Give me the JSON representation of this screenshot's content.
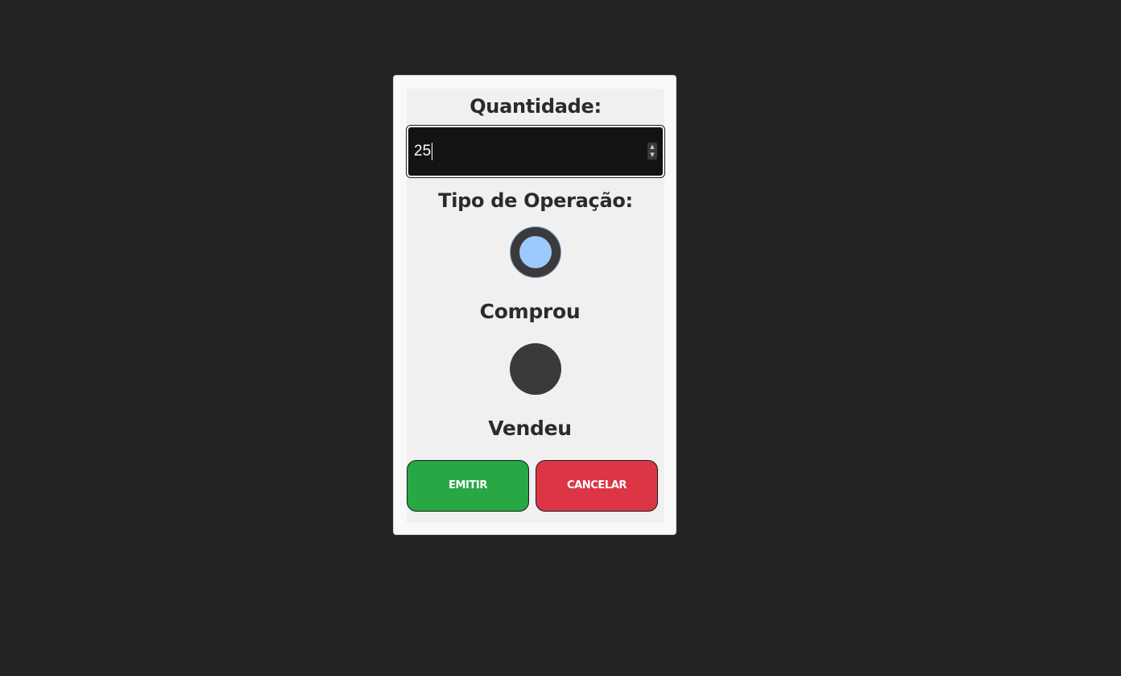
{
  "form": {
    "quantity_label": "Quantidade:",
    "quantity_value": "25",
    "operation_label": "Tipo de Operação:",
    "options": [
      {
        "label": "Comprou",
        "selected": true
      },
      {
        "label": "Vendeu",
        "selected": false
      }
    ],
    "emit_label": "EMITIR",
    "cancel_label": "CANCELAR"
  },
  "colors": {
    "background": "#232323",
    "card": "#f9f9f9",
    "panel": "#f0f0f0",
    "input_bg": "#131313",
    "radio": "#3a3a3a",
    "radio_selected_dot": "#9ec9ff",
    "emit": "#28a745",
    "cancel": "#dc3545"
  },
  "icons": {
    "stepper_up": "chevron-up-icon",
    "stepper_down": "chevron-down-icon"
  }
}
